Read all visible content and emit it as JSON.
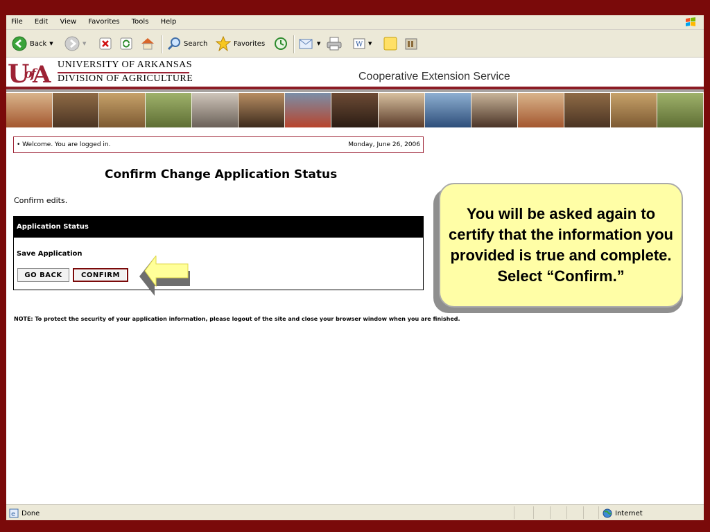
{
  "menu": [
    "File",
    "Edit",
    "View",
    "Favorites",
    "Tools",
    "Help"
  ],
  "toolbar": {
    "back_label": "Back",
    "search_label": "Search",
    "favorites_label": "Favorites"
  },
  "header": {
    "logo_mark": "UofA",
    "line1": "UNIVERSITY OF ARKANSAS",
    "line2": "DIVISION OF AGRICULTURE",
    "service": "Cooperative Extension Service"
  },
  "welcome": {
    "message": "• Welcome. You are logged in.",
    "date": "Monday, June 26, 2006"
  },
  "page": {
    "title": "Confirm Change Application Status",
    "subtitle": "Confirm edits.",
    "panel_header": "Application Status",
    "save_label": "Save Application",
    "go_back": "GO BACK",
    "confirm": "CONFIRM",
    "note": "NOTE:   To protect the security of your application information, please logout of the site and close your browser window when you are finished."
  },
  "callout": {
    "text": "You will be asked again to certify that the information you provided is true and complete. Select “Confirm.”"
  },
  "status": {
    "done": "Done",
    "zone": "Internet"
  },
  "colors": {
    "slide_bg": "#7a0a0a",
    "brand": "#9d2235",
    "callout_bg": "#fffea6",
    "arrow": "#ffff99"
  }
}
